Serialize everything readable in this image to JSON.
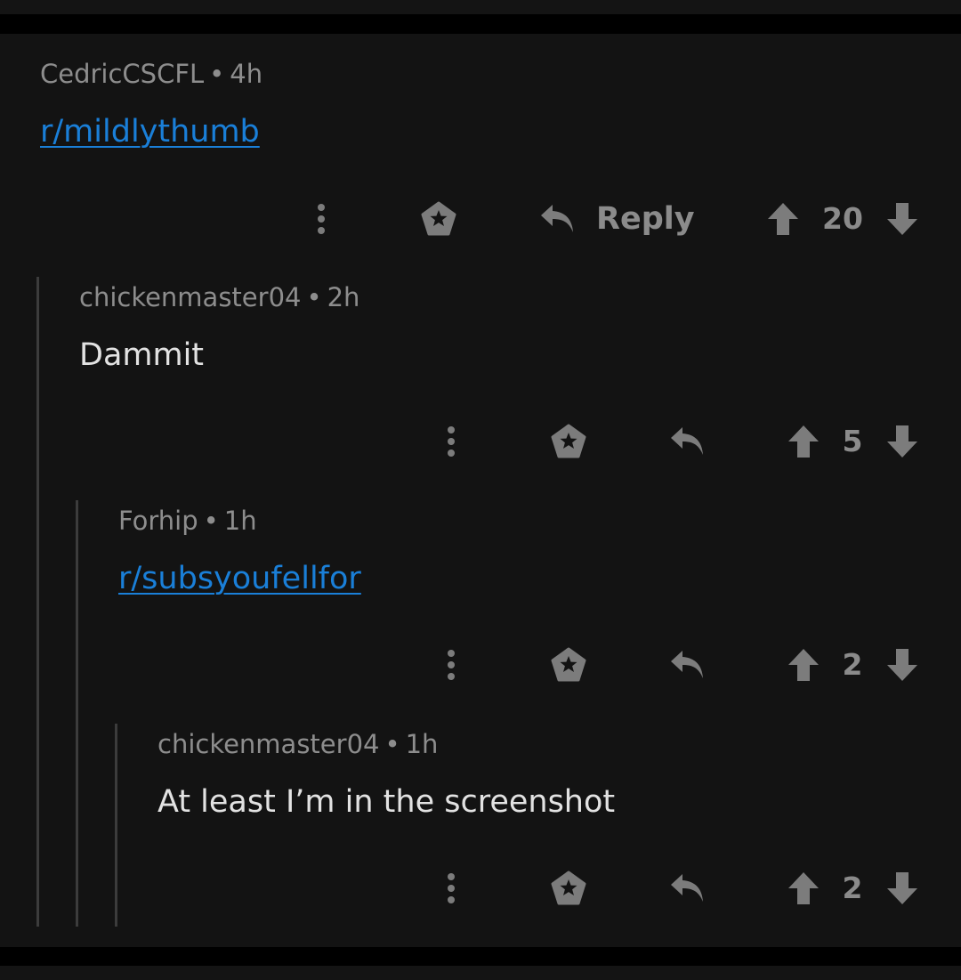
{
  "comments": [
    {
      "username": "CedricCSCFL",
      "separator": "•",
      "age": "4h",
      "body": "r/mildlythumb",
      "is_link": true,
      "reply_label": "Reply",
      "score": "20"
    },
    {
      "username": "chickenmaster04",
      "separator": "•",
      "age": "2h",
      "body": "Dammit",
      "is_link": false,
      "score": "5"
    },
    {
      "username": "Forhip",
      "separator": "•",
      "age": "1h",
      "body": "r/subsyoufellfor",
      "is_link": true,
      "score": "2"
    },
    {
      "username": "chickenmaster04",
      "separator": "•",
      "age": "1h",
      "body": "At least I’m in the screenshot",
      "is_link": false,
      "score": "2"
    }
  ],
  "icons": {
    "more": "more-vertical-icon",
    "award": "award-icon",
    "reply": "reply-arrow-icon",
    "upvote": "upvote-arrow-icon",
    "downvote": "downvote-arrow-icon"
  },
  "colors": {
    "background": "#131313",
    "link": "#1a7fd8",
    "meta_text": "#8d8d8d",
    "body_text": "#e2e2e2",
    "icon": "#7c7c7c",
    "thread_line": "#3c3c3c"
  }
}
